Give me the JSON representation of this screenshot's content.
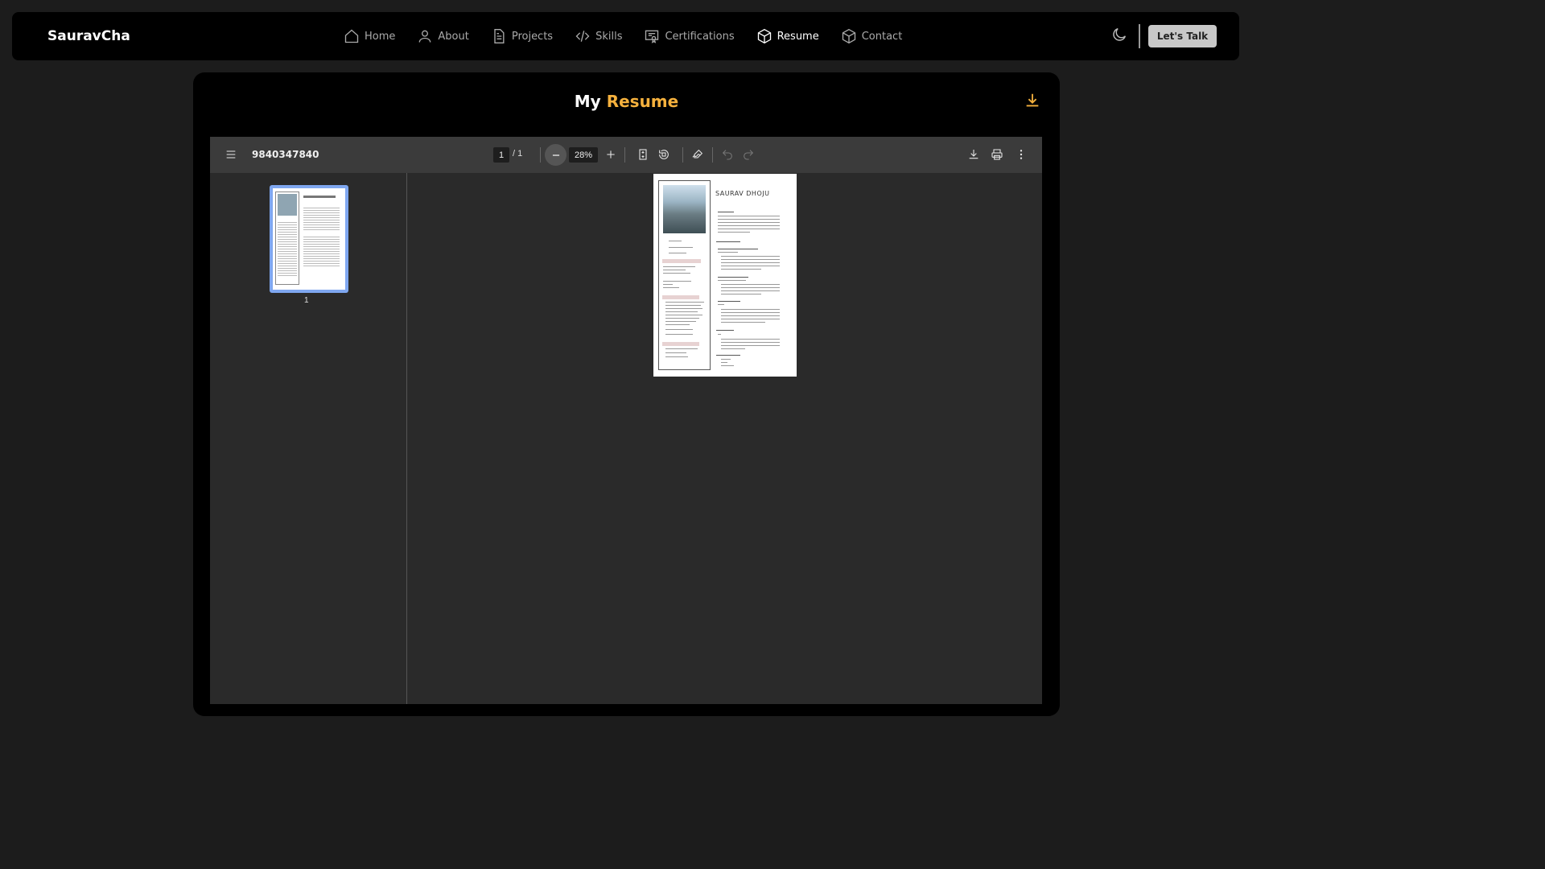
{
  "brand": "SauravCha",
  "nav": [
    {
      "label": "Home",
      "icon": "home-icon"
    },
    {
      "label": "About",
      "icon": "user-icon"
    },
    {
      "label": "Projects",
      "icon": "document-icon"
    },
    {
      "label": "Skills",
      "icon": "code-icon"
    },
    {
      "label": "Certifications",
      "icon": "certificate-icon"
    },
    {
      "label": "Resume",
      "icon": "cube-icon",
      "active": true
    },
    {
      "label": "Contact",
      "icon": "cube-icon"
    }
  ],
  "cta": "Let's Talk",
  "title": {
    "prefix": "My",
    "accent": "Resume"
  },
  "accent_color": "#f5b13d",
  "viewer": {
    "file_name": "9840347840",
    "current_page": "1",
    "total_pages": "/  1",
    "zoom": "28%",
    "thumb_page": "1"
  },
  "resume": {
    "name": "SAURAV DHOJU"
  }
}
